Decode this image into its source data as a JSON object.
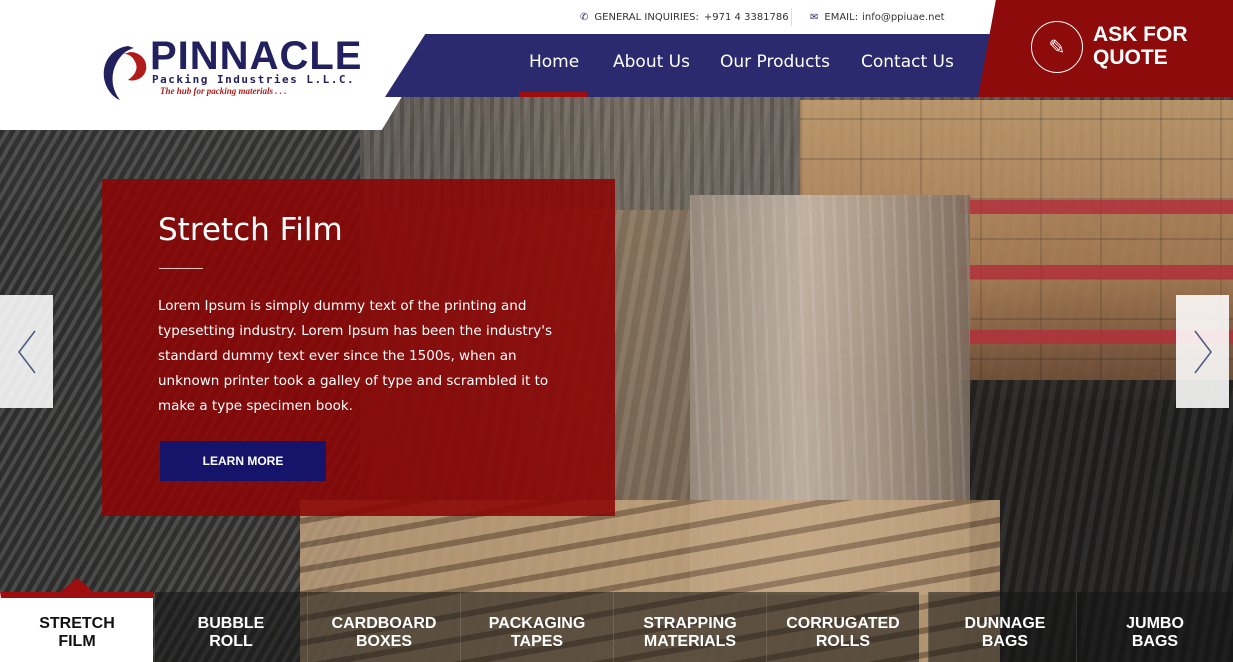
{
  "brand": {
    "name": "PINNACLE",
    "subtitle": "Packing Industries L.L.C.",
    "tagline": "The hub for packing materials . . ."
  },
  "contact": {
    "phone_label": "GENERAL INQUIRIES:",
    "phone": "+971 4 3381786",
    "email_label": "EMAIL:",
    "email": "info@ppiuae.net"
  },
  "nav": {
    "items": [
      {
        "label": "Home",
        "active": true
      },
      {
        "label": "About Us"
      },
      {
        "label": "Our Products"
      },
      {
        "label": "Contact Us"
      }
    ]
  },
  "quote": {
    "line1": "ASK FOR",
    "line2": "QUOTE",
    "icon": "pencil-icon"
  },
  "slide": {
    "title": "Stretch Film",
    "body": "Lorem Ipsum is simply dummy text of the printing and typesetting industry. Lorem Ipsum has been the industry's standard dummy text ever since the 1500s, when an unknown printer took a galley of type and scrambled it to make a type specimen book.",
    "button": "LEARN MORE"
  },
  "tabs": [
    {
      "line1": "STRETCH",
      "line2": "FILM",
      "active": true
    },
    {
      "line1": "BUBBLE",
      "line2": "ROLL"
    },
    {
      "line1": "CARDBOARD",
      "line2": "BOXES"
    },
    {
      "line1": "PACKAGING",
      "line2": "TAPES"
    },
    {
      "line1": "STRAPPING",
      "line2": "MATERIALS"
    },
    {
      "line1": "CORRUGATED",
      "line2": "ROLLS"
    },
    {
      "line1": "DUNNAGE",
      "line2": "BAGS"
    },
    {
      "line1": "JUMBO",
      "line2": "BAGS"
    }
  ],
  "colors": {
    "navy": "#2b2a6e",
    "red": "#8e0b0b",
    "button_navy": "#16136a"
  }
}
